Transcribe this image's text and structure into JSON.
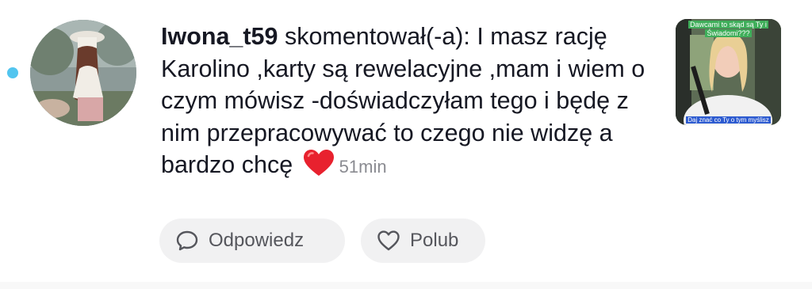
{
  "comment": {
    "username": "Iwona_t59",
    "action": "skomentował(-a):",
    "text": "I masz rację Karolino ,karty są rewelacyjne ,mam i wiem o czym mówisz -doświadczyłam tego i będę z nim przepracowywać to czego nie widzę a bardzo chcę",
    "emoji": "heart-emoji",
    "time": "51min"
  },
  "thumbnail": {
    "caption_top_line1": "Dawcami to skąd są Ty i",
    "caption_top_line2": "Świadomi???",
    "caption_bottom": "Daj znać co Ty o tym myślisz"
  },
  "actions": {
    "reply_label": "Odpowiedz",
    "like_label": "Polub"
  },
  "colors": {
    "unread_dot": "#52c5ef",
    "button_bg": "#f1f1f2",
    "secondary_text": "#8a8b91",
    "heart": "#e8212e"
  }
}
